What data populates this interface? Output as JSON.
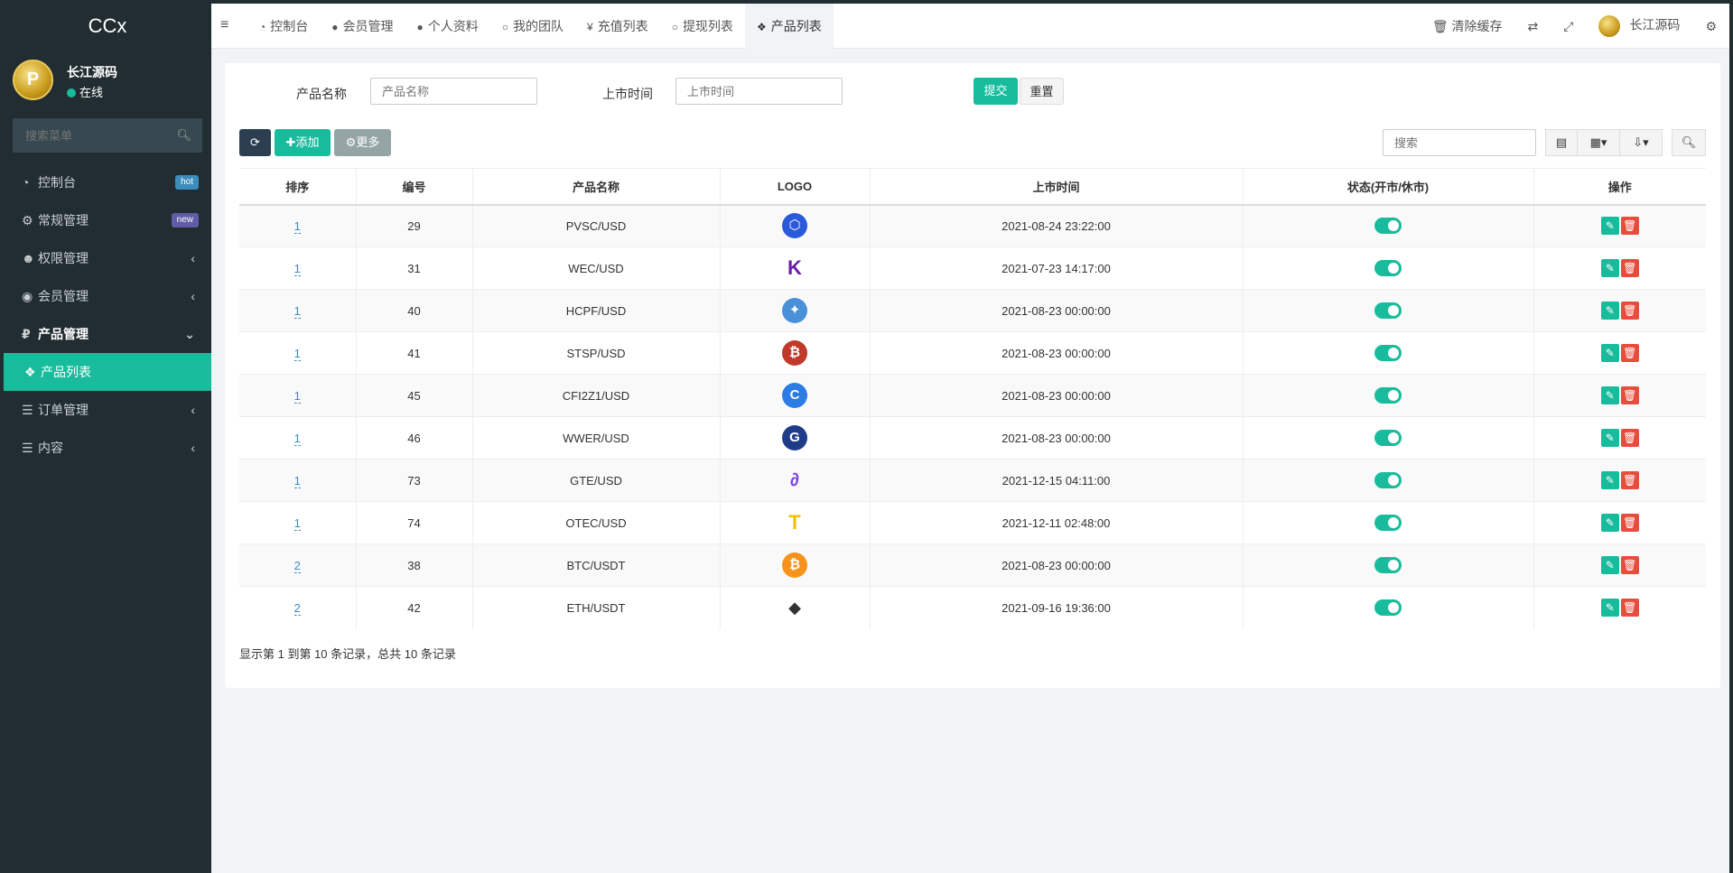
{
  "app": {
    "title": "CCx"
  },
  "user": {
    "name": "长江源码",
    "status": "在线"
  },
  "sidebar": {
    "search_placeholder": "搜索菜单",
    "items": [
      {
        "label": "控制台",
        "badge": "hot"
      },
      {
        "label": "常规管理",
        "badge": "new"
      },
      {
        "label": "权限管理"
      },
      {
        "label": "会员管理"
      },
      {
        "label": "产品管理"
      },
      {
        "label": "产品列表"
      },
      {
        "label": "订单管理"
      },
      {
        "label": "内容"
      }
    ]
  },
  "topbar": {
    "tabs": [
      "控制台",
      "会员管理",
      "个人资料",
      "我的团队",
      "充值列表",
      "提现列表",
      "产品列表"
    ],
    "clear_cache": "清除缓存",
    "user_name": "长江源码"
  },
  "filter": {
    "name_label": "产品名称",
    "name_placeholder": "产品名称",
    "time_label": "上市时间",
    "time_placeholder": "上市时间",
    "submit": "提交",
    "reset": "重置"
  },
  "toolbar": {
    "add": "添加",
    "more": "更多",
    "search_placeholder": "搜索"
  },
  "table": {
    "columns": [
      "排序",
      "编号",
      "产品名称",
      "LOGO",
      "上市时间",
      "状态(开市/休市)",
      "操作"
    ],
    "rows": [
      {
        "sort": "1",
        "id": "29",
        "name": "PVSC/USD",
        "time": "2021-08-24 23:22:00"
      },
      {
        "sort": "1",
        "id": "31",
        "name": "WEC/USD",
        "time": "2021-07-23 14:17:00"
      },
      {
        "sort": "1",
        "id": "40",
        "name": "HCPF/USD",
        "time": "2021-08-23 00:00:00"
      },
      {
        "sort": "1",
        "id": "41",
        "name": "STSP/USD",
        "time": "2021-08-23 00:00:00"
      },
      {
        "sort": "1",
        "id": "45",
        "name": "CFI2Z1/USD",
        "time": "2021-08-23 00:00:00"
      },
      {
        "sort": "1",
        "id": "46",
        "name": "WWER/USD",
        "time": "2021-08-23 00:00:00"
      },
      {
        "sort": "1",
        "id": "73",
        "name": "GTE/USD",
        "time": "2021-12-15 04:11:00"
      },
      {
        "sort": "1",
        "id": "74",
        "name": "OTEC/USD",
        "time": "2021-12-11 02:48:00"
      },
      {
        "sort": "2",
        "id": "38",
        "name": "BTC/USDT",
        "time": "2021-08-23 00:00:00"
      },
      {
        "sort": "2",
        "id": "42",
        "name": "ETH/USDT",
        "time": "2021-09-16 19:36:00"
      }
    ]
  },
  "pagination": {
    "info": "显示第 1 到第 10 条记录，总共 10 条记录"
  },
  "colors": {
    "accent": "#18bc9c",
    "sidebar_bg": "#222d32",
    "danger": "#e74c3c"
  }
}
